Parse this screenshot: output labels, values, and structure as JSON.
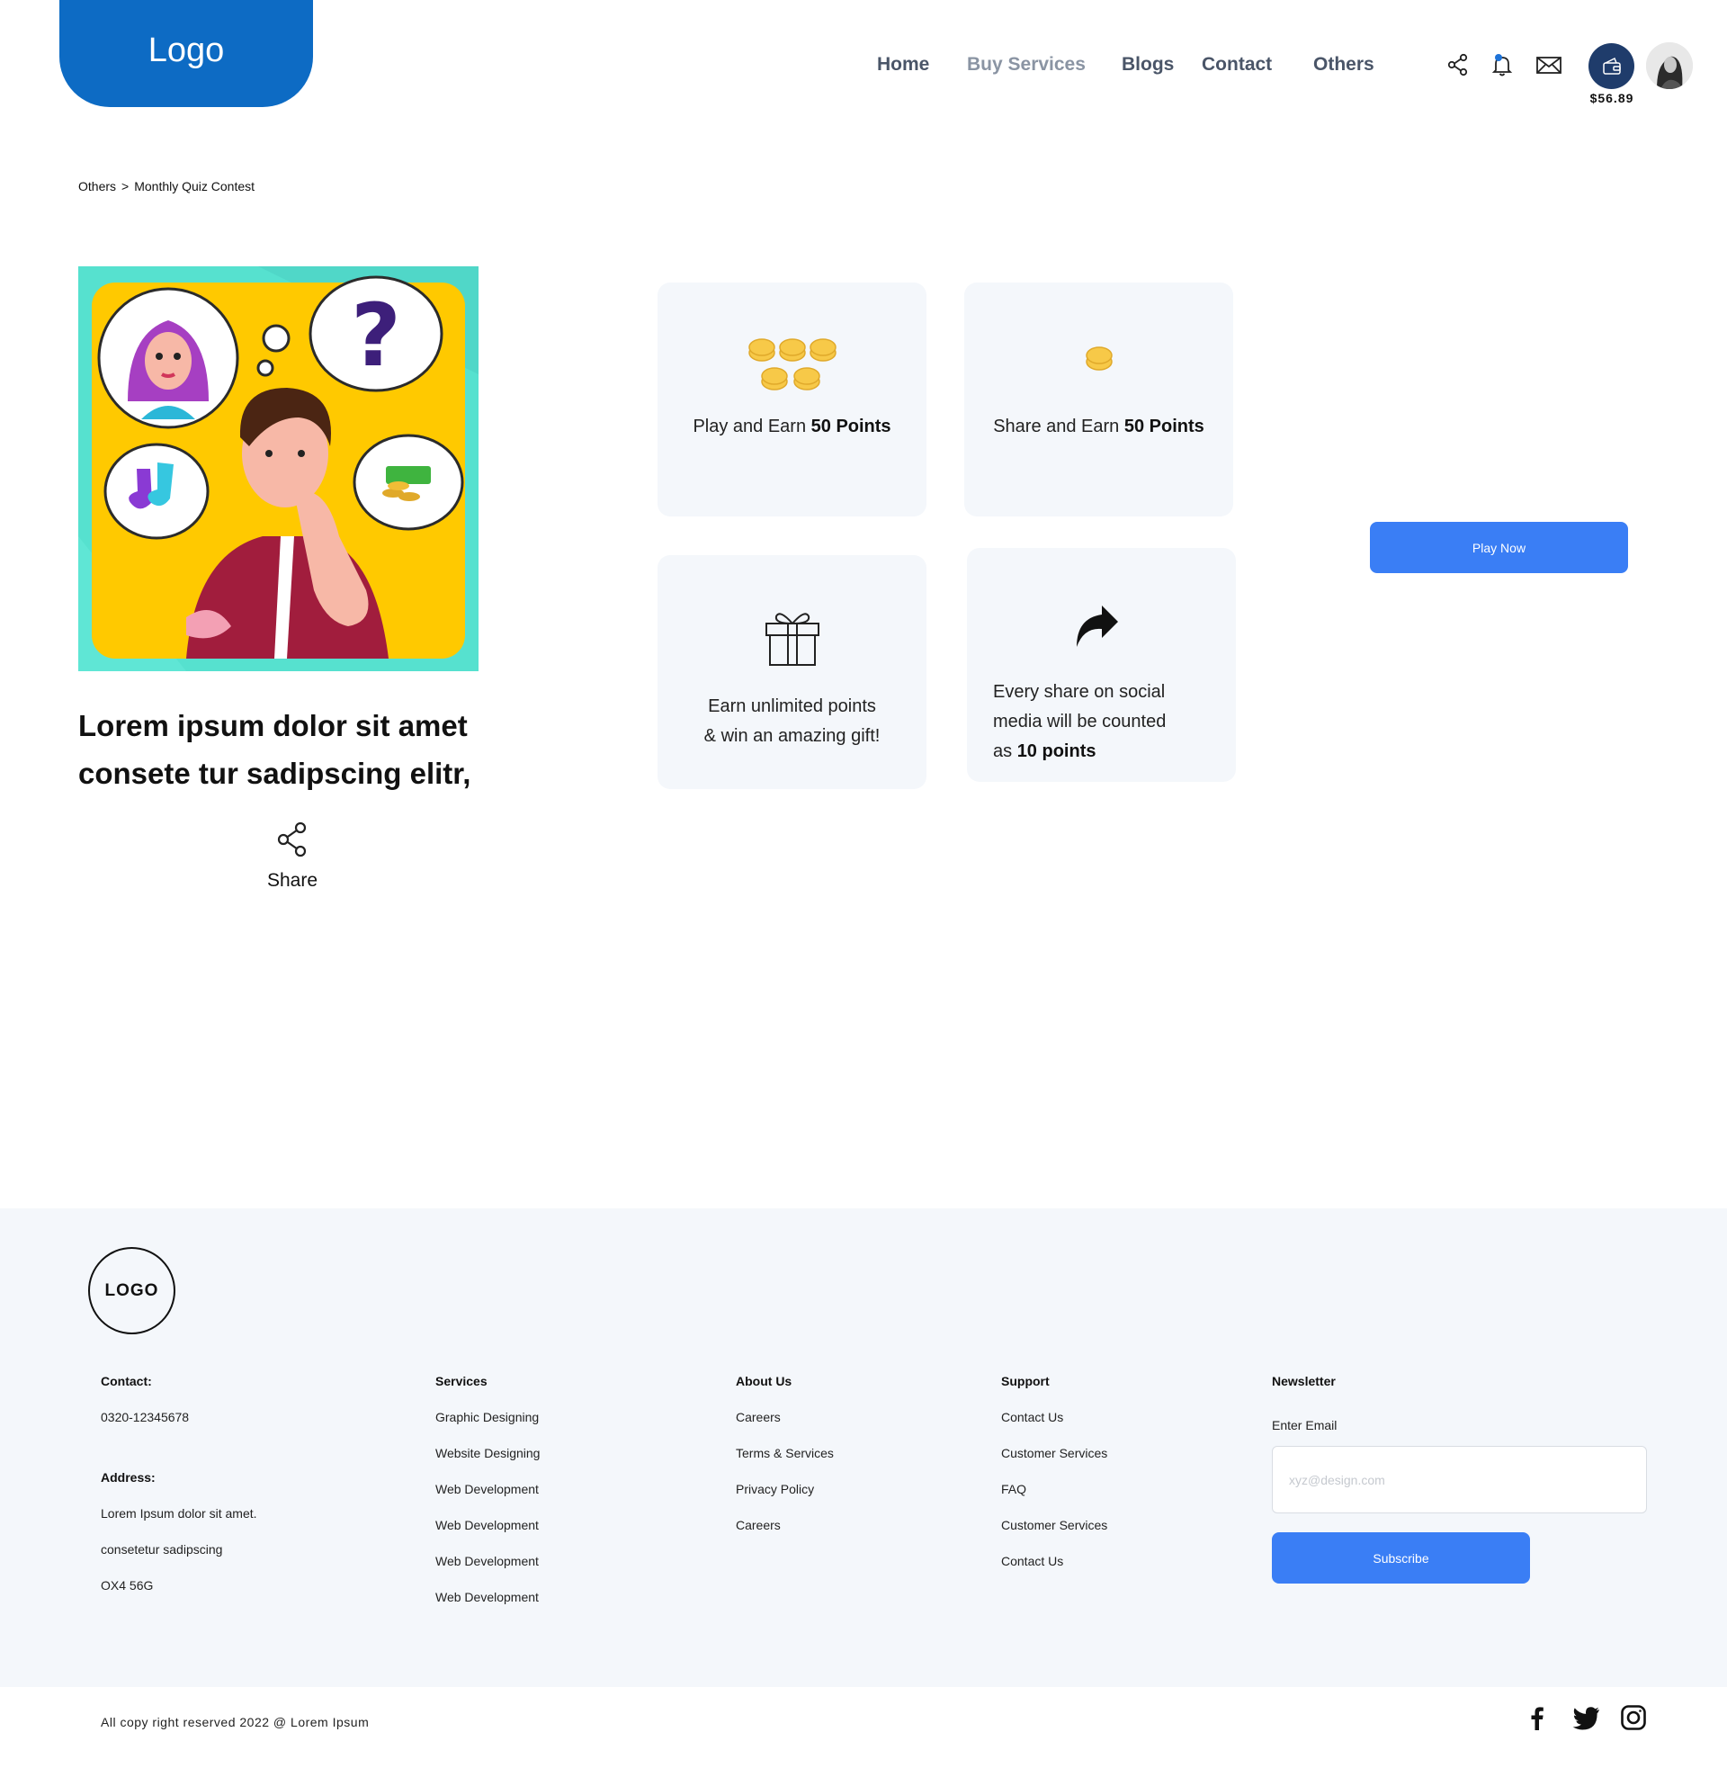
{
  "header": {
    "logo": "Logo",
    "nav": {
      "home": "Home",
      "buy_services": "Buy Services",
      "blogs": "Blogs",
      "contact": "Contact",
      "others": "Others"
    },
    "icons": [
      "share-icon",
      "bell-icon",
      "mail-icon",
      "wallet-icon"
    ],
    "balance": "$56.89",
    "colors": {
      "logo_bg": "#0d6bc4",
      "nav_text": "#4a5568",
      "wallet_bg": "#1f3c6b",
      "notification_dot": "#1e73d8"
    }
  },
  "breadcrumb": {
    "parent": "Others",
    "separator": ">",
    "current": "Monthly Quiz Contest"
  },
  "quiz": {
    "headline_line1": "Lorem ipsum dolor sit amet",
    "headline_line2": "consete tur sadipscing elitr,",
    "share_label": "Share"
  },
  "cards": {
    "play": {
      "text": "Play and Earn",
      "points": "50 Points",
      "icon": "coins-stack-icon"
    },
    "share": {
      "text": "Share and Earn",
      "points": "50 Points",
      "icon": "coin-icon"
    },
    "gift": {
      "line1": "Earn unlimited points",
      "line2": "& win an amazing gift!",
      "icon": "gift-icon"
    },
    "social": {
      "line1": "Every share on social",
      "line2": "media will be counted",
      "line3_prefix": "as",
      "points": "10 points",
      "icon": "share-arrow-icon"
    }
  },
  "play_button": "Play Now",
  "footer": {
    "logo": "LOGO",
    "contact": {
      "heading": "Contact:",
      "phone": "0320-12345678",
      "address_heading": "Address:",
      "address_lines": [
        "Lorem Ipsum dolor sit amet.",
        "consetetur sadipscing",
        "OX4 56G"
      ]
    },
    "services": {
      "heading": "Services",
      "items": [
        "Graphic Designing",
        "Website Designing",
        "Web Development",
        "Web Development",
        "Web Development",
        "Web Development"
      ]
    },
    "about": {
      "heading": "About Us",
      "items": [
        "Careers",
        "Terms & Services",
        "Privacy Policy",
        "Careers"
      ]
    },
    "support": {
      "heading": "Support",
      "items": [
        "Contact Us",
        "Customer Services",
        "FAQ",
        "Customer Services",
        "Contact Us"
      ]
    },
    "newsletter": {
      "heading": "Newsletter",
      "email_label": "Enter Email",
      "email_placeholder": "xyz@design.com",
      "email_value": "",
      "subscribe": "Subscribe"
    },
    "copyright": "All copy right reserved 2022 @ Lorem Ipsum",
    "social": [
      "facebook-icon",
      "twitter-icon",
      "instagram-icon"
    ],
    "colors": {
      "background": "#f4f7fb",
      "button": "#3a7ef5"
    }
  }
}
